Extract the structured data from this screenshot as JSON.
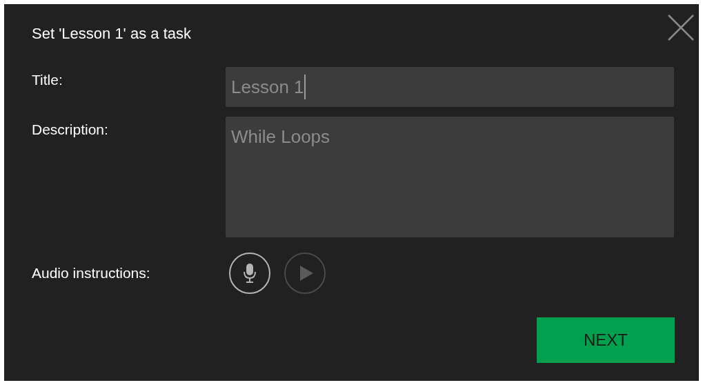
{
  "dialog": {
    "title": "Set 'Lesson 1' as a task"
  },
  "fields": [
    {
      "label": "Title:",
      "value": "Lesson 1",
      "kind": "line"
    },
    {
      "label": "Description:",
      "value": "While Loops",
      "kind": "area"
    }
  ],
  "audio": {
    "label": "Audio instructions:",
    "record_disabled": false,
    "play_disabled": true
  },
  "buttons": {
    "next": "NEXT"
  }
}
